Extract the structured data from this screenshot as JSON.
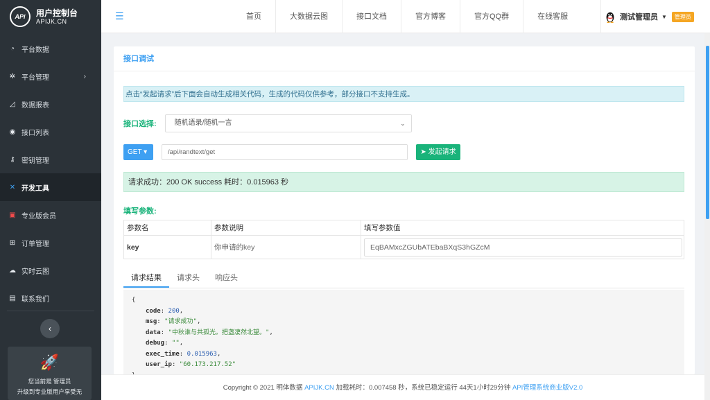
{
  "brand": {
    "logo_text": "APi",
    "title": "用户控制台",
    "domain": "APIJK.CN"
  },
  "sidebar": {
    "items": [
      {
        "label": "平台数据",
        "icon": "dashboard-icon"
      },
      {
        "label": "平台管理",
        "icon": "gear-icon",
        "has_arrow": true
      },
      {
        "label": "数据报表",
        "icon": "area-chart-icon"
      },
      {
        "label": "接口列表",
        "icon": "circle-icon"
      },
      {
        "label": "密钥管理",
        "icon": "key-icon"
      },
      {
        "label": "开发工具",
        "icon": "tools-icon",
        "active": true
      },
      {
        "label": "专业版会员",
        "icon": "vip-icon"
      },
      {
        "label": "订单管理",
        "icon": "table-icon"
      },
      {
        "label": "实时云图",
        "icon": "cloud-icon"
      },
      {
        "label": "联系我们",
        "icon": "contact-card-icon"
      }
    ],
    "collapse_icon": "chevron-left-icon",
    "promo": {
      "line1": "您当前是 管理员",
      "line2": "升级到专业版用户享受无"
    }
  },
  "header": {
    "nav": [
      "首页",
      "大数据云图",
      "接口文档",
      "官方博客",
      "官方QQ群",
      "在线客服"
    ],
    "user": {
      "name": "测试管理员",
      "badge": "管理员"
    }
  },
  "panel": {
    "title": "接口调试",
    "notice": "点击“发起请求”后下面会自动生成相关代码，生成的代码仅供参考，部分接口不支持生成。",
    "api_label": "接口选择:",
    "api_selected": "随机语录/随机一言",
    "method": "GET",
    "url": "/api/randtext/get",
    "send_label": "发起请求",
    "success": "请求成功：200 OK success 耗时：0.015963 秒",
    "params_label": "填写参数:",
    "table": {
      "headers": [
        "参数名",
        "参数说明",
        "填写参数值"
      ],
      "rows": [
        {
          "name": "key",
          "desc": "你申请的key",
          "value": "EqBAMxcZGUbATEbaBXqS3hGZcM"
        }
      ]
    },
    "tabs": [
      "请求结果",
      "请求头",
      "响应头"
    ],
    "result": {
      "code": "200",
      "msg": "\"请求成功\"",
      "data": "\"中秋谁与共孤光。把盏凄然北望。\"",
      "debug": "\"\"",
      "exec_time": "0.015963",
      "user_ip": "\"60.173.217.52\""
    }
  },
  "footer": {
    "prefix": "Copyright © 2021 明体数据 ",
    "site": "APIJK.CN",
    "middle": " 加载耗时：0.007458 秒，系统已稳定运行 44天1小时29分钟 ",
    "version": "API管理系统商业版V2.0"
  },
  "colors": {
    "accent": "#3ea0f2",
    "green": "#19b37a",
    "sidebar": "#2b3238",
    "badge": "#f5a623"
  }
}
